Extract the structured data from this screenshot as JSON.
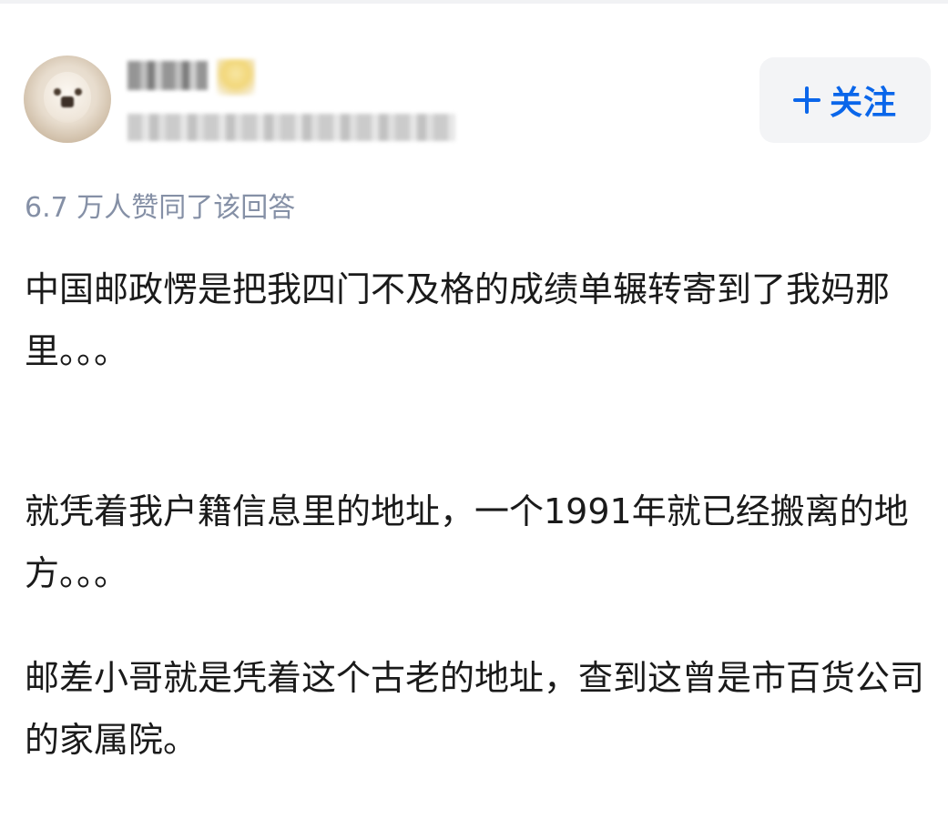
{
  "author": {
    "avatar_icon": "poodle-avatar",
    "name": "",
    "headline": ""
  },
  "follow_button": {
    "icon": "plus-icon",
    "label": "关注",
    "color": "#0a66ea"
  },
  "answer": {
    "upvote_summary": "6.7 万人赞同了该回答",
    "paragraphs": [
      "中国邮政愣是把我四门不及格的成绩单辗转寄到了我妈那里。。。",
      "就凭着我户籍信息里的地址，一个1991年就已经搬离的地方。。。",
      "邮差小哥就是凭着这个古老的地址，查到这曾是市百货公司的家属院。"
    ]
  }
}
